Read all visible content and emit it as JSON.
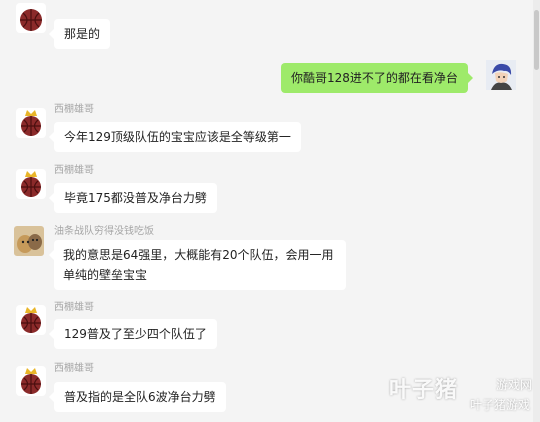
{
  "messages": [
    {
      "sender": "",
      "text": "那是的"
    },
    {
      "sender": "me",
      "text": "你酷哥128进不了的都在看净台"
    },
    {
      "sender": "西棚雄哥",
      "text": "今年129顶级队伍的宝宝应该是全等级第一"
    },
    {
      "sender": "西棚雄哥",
      "text": "毕竟175都没普及净台力劈"
    },
    {
      "sender": "油条战队穷得没钱吃饭",
      "text": "我的意思是64强里，大概能有20个队伍，会用一用单纯的壁垒宝宝"
    },
    {
      "sender": "西棚雄哥",
      "text": "129普及了至少四个队伍了"
    },
    {
      "sender": "西棚雄哥",
      "text": "普及指的是全队6波净台力劈"
    }
  ],
  "watermark": {
    "big": "叶子猪",
    "small_top": "游戏网",
    "small_bottom": "叶子猪游戏"
  },
  "colors": {
    "background": "#f4f4f4",
    "bubble_other": "#ffffff",
    "bubble_mine": "#9eea6a",
    "nickname": "#a6a6a6"
  }
}
